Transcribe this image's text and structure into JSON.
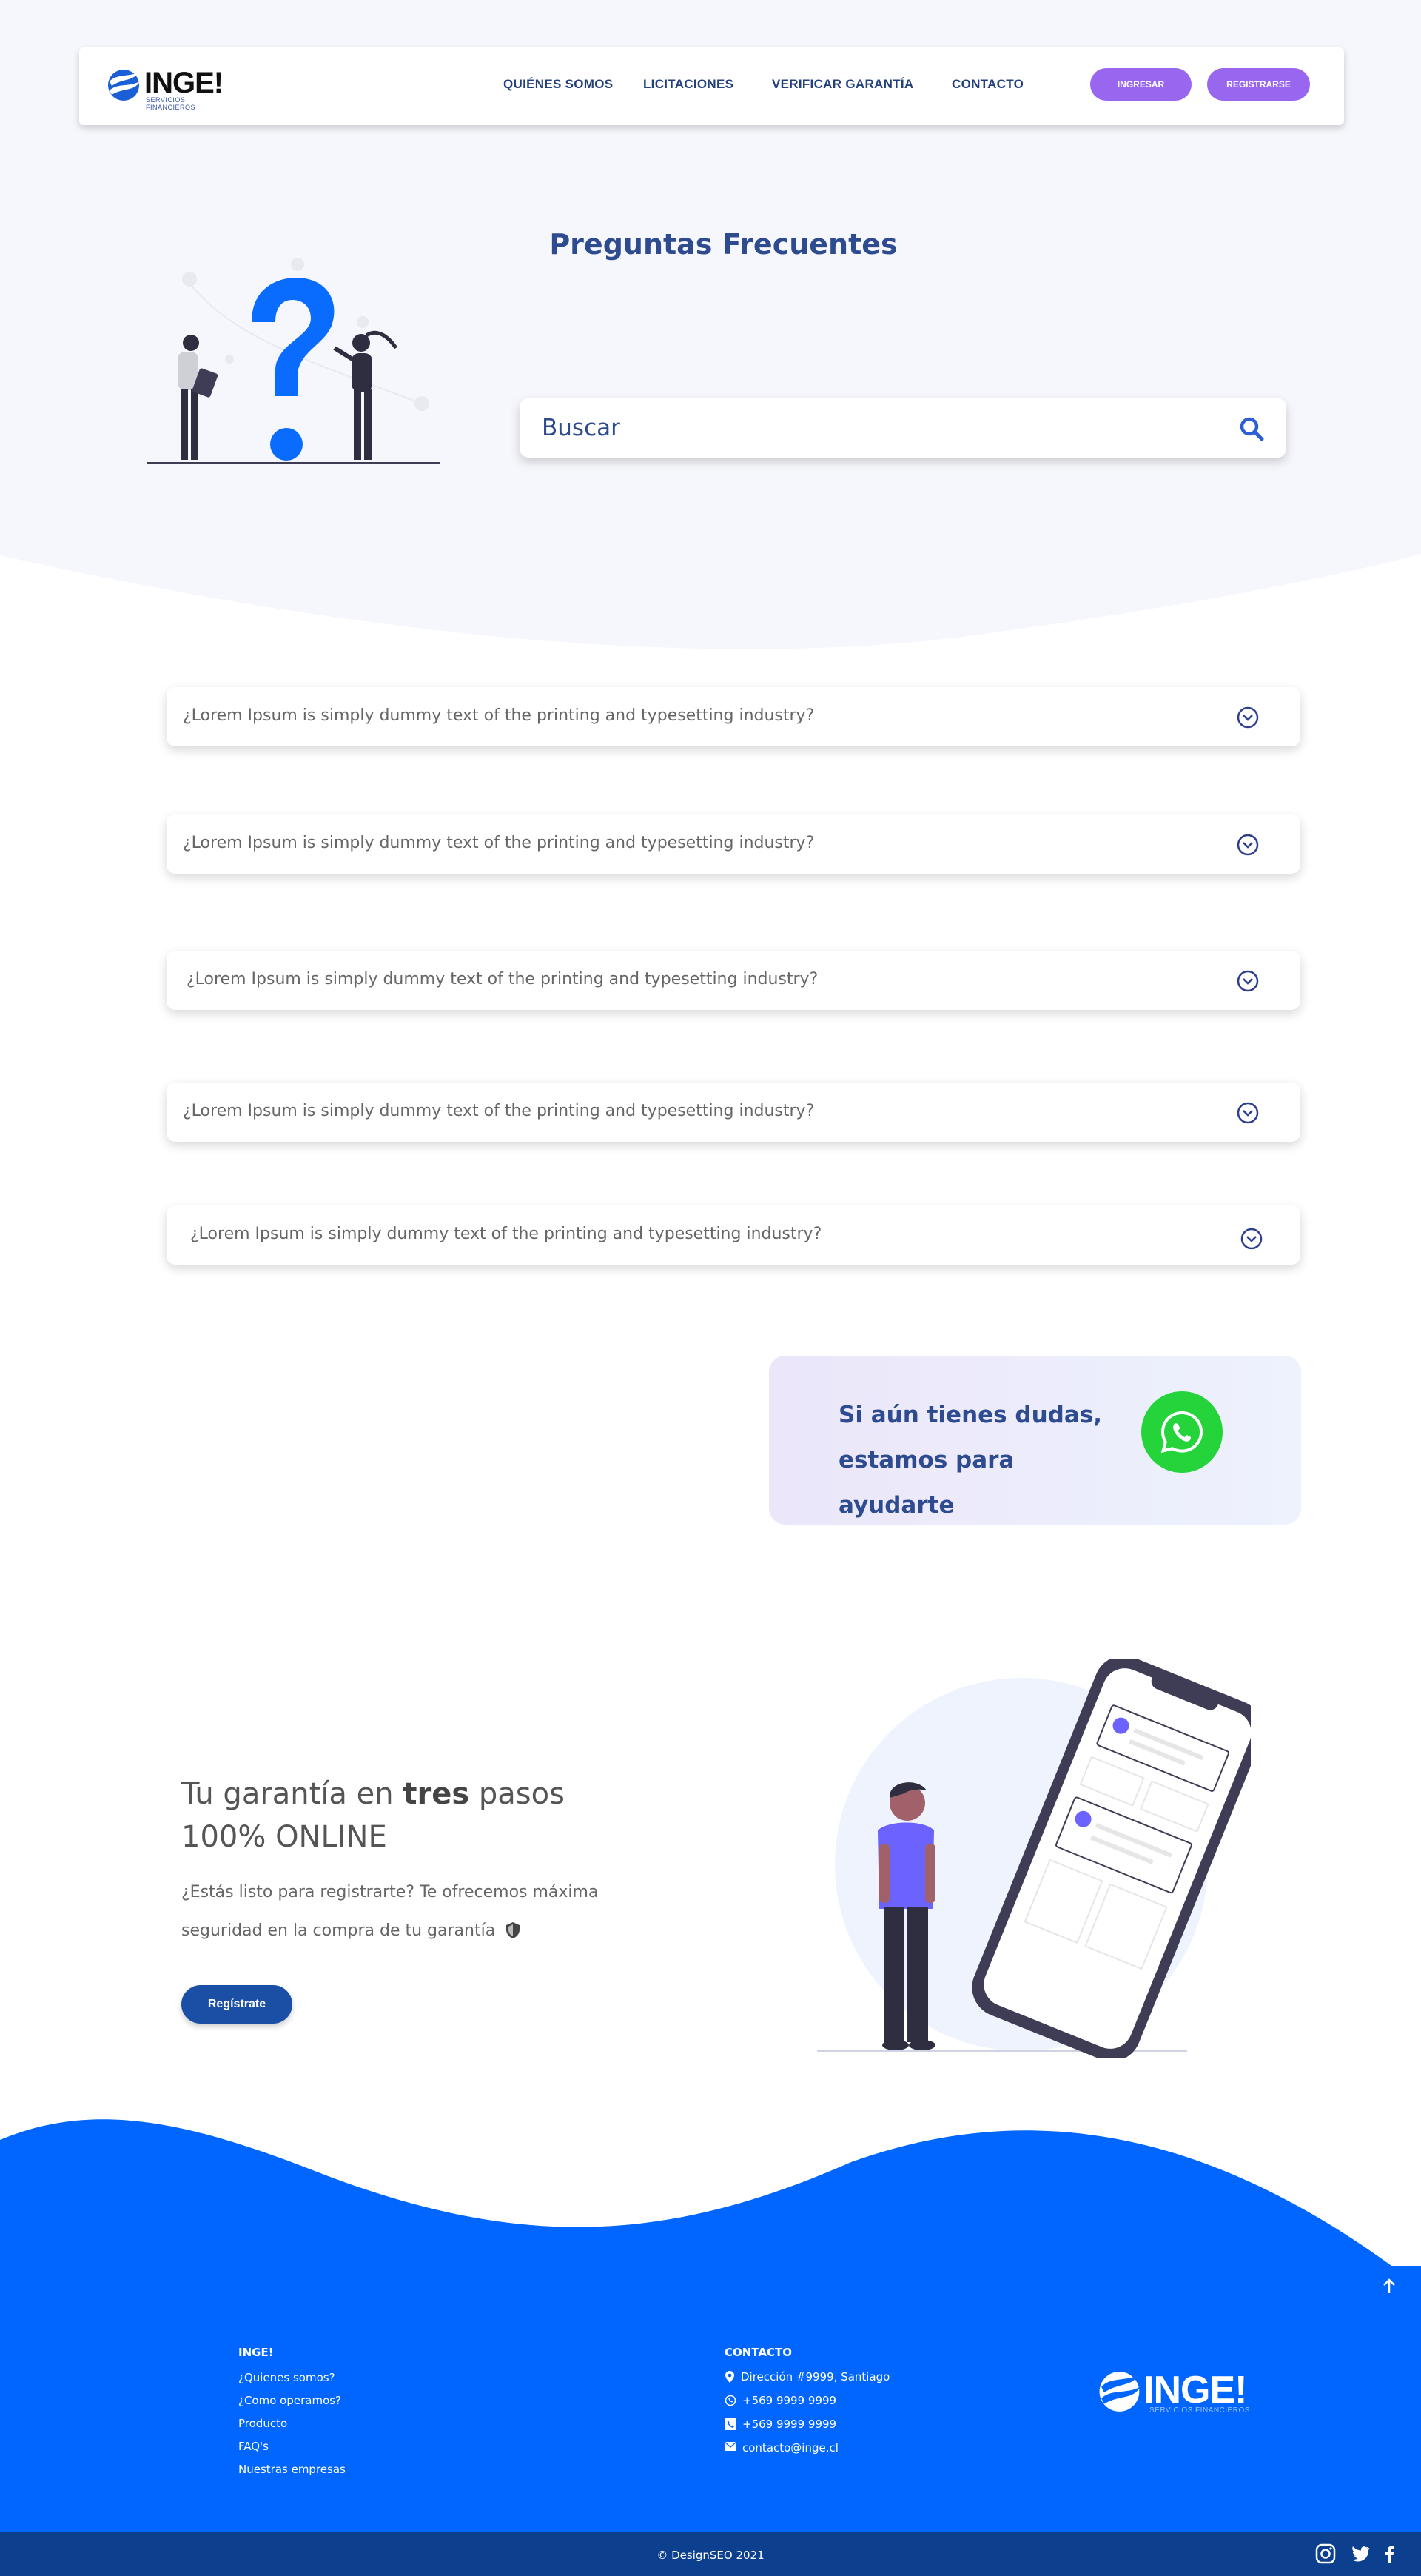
{
  "header": {
    "logo_text": "INGE!",
    "logo_sub": "SERVICIOS FINANCIEROS",
    "nav": [
      "QUIÉNES SOMOS",
      "LICITACIONES",
      "VERIFICAR GARANTÍA",
      "CONTACTO"
    ],
    "login_label": "INGRESAR",
    "register_label": "REGISTRARSE"
  },
  "hero": {
    "title": "Preguntas Frecuentes",
    "search_placeholder": "Buscar"
  },
  "faq": [
    "¿Lorem Ipsum is simply dummy text of the printing and typesetting industry?",
    "¿Lorem Ipsum is simply dummy text of the printing and typesetting industry?",
    "¿Lorem Ipsum is simply dummy text of the printing and typesetting industry?",
    "¿Lorem Ipsum is simply dummy text of the printing and typesetting industry?",
    "¿Lorem Ipsum is simply dummy text of the printing and typesetting industry?"
  ],
  "help": {
    "line1": "Si aún tienes dudas,",
    "line2": "estamos para ayudarte"
  },
  "promo": {
    "title_pre": "Tu garantía en ",
    "title_bold": "tres",
    "title_post": " pasos",
    "title_line2": "100% ONLINE",
    "text": "¿Estás listo para registrarte? Te ofrecemos máxima seguridad en la compra de tu garantía",
    "button": "Regístrate"
  },
  "footer": {
    "col1_title": "INGE!",
    "col1_links": [
      "¿Quienes somos?",
      "¿Como operamos?",
      "Producto",
      "FAQ's",
      "Nuestras empresas"
    ],
    "contact_title": "CONTACTO",
    "address": "Dirección #9999, Santiago",
    "whatsapp": "+569 9999 9999",
    "phone": "+569 9999 9999",
    "email": "contacto@inge.cl",
    "logo_text": "INGE!",
    "logo_sub": "SERVICIOS FINANCIEROS",
    "copyright": "© DesignSEO 2021"
  },
  "colors": {
    "brand_blue": "#0066ff",
    "dark_blue": "#2d4b8e",
    "purple": "#9966f0",
    "whatsapp_green": "#25d33b"
  },
  "icons": [
    "search-icon",
    "chevron-down-icon",
    "whatsapp-icon",
    "shield-icon",
    "map-pin-icon",
    "phone-icon",
    "mail-icon",
    "arrow-up-icon",
    "instagram-icon",
    "twitter-icon",
    "facebook-icon"
  ]
}
